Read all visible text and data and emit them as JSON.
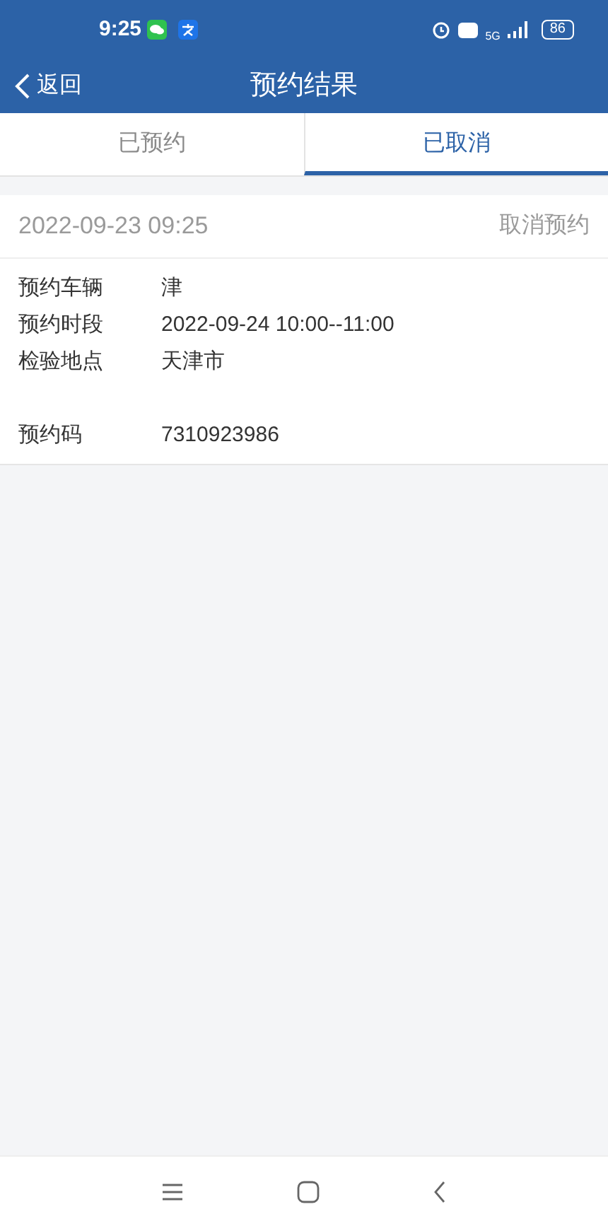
{
  "status_bar": {
    "time": "9:25",
    "battery": "86",
    "network": "5G"
  },
  "header": {
    "back_label": "返回",
    "title": "预约结果"
  },
  "tabs": [
    {
      "label": "已预约",
      "selected": false
    },
    {
      "label": "已取消",
      "selected": true
    }
  ],
  "record": {
    "created": "2022-09-23 09:25",
    "action": "取消预约",
    "fields": [
      {
        "label": "预约车辆",
        "value": "津"
      },
      {
        "label": "预约时段",
        "value": "2022-09-24 10:00--11:00"
      },
      {
        "label": "检验地点",
        "value": "天津市",
        "extra_line": true
      },
      {
        "label": "预约码",
        "value": "7310923986"
      }
    ]
  }
}
